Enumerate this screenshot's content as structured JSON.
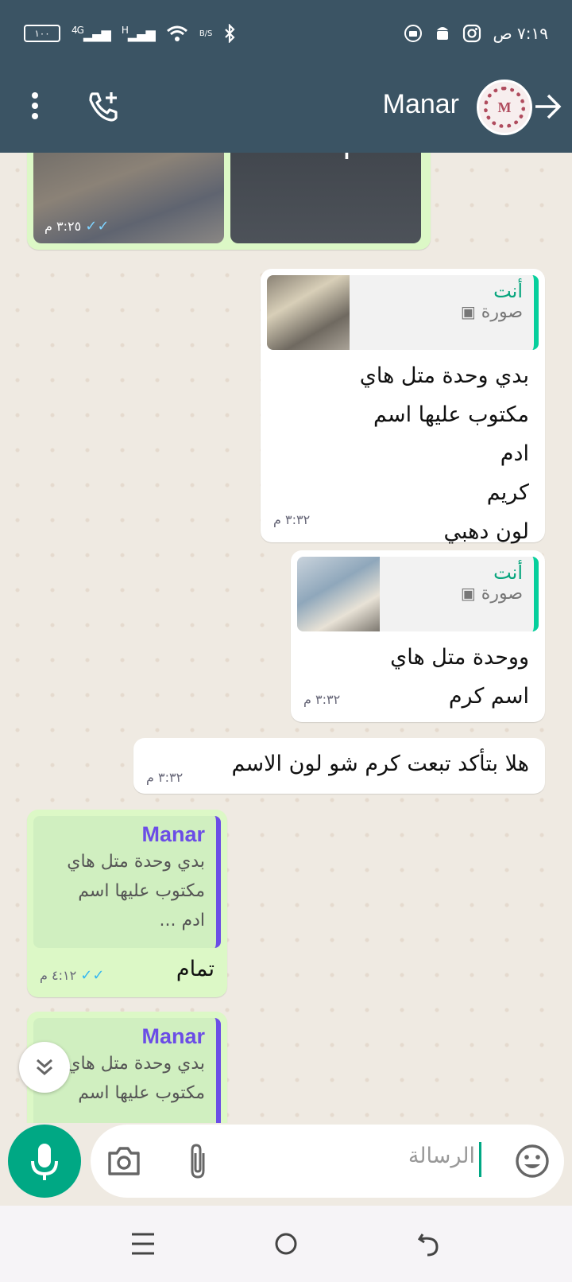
{
  "status_bar": {
    "time": "٧:١٩ ص",
    "battery": "١٠٠",
    "network_4g": "4G",
    "network_h": "H",
    "speed_unit": "B/S"
  },
  "header": {
    "contact_name": "Manar",
    "avatar_letter": "M",
    "colors": {
      "header_bg": "#3b5464",
      "accent": "#00a884"
    }
  },
  "messages": {
    "photo_time": "٣:٢٥ م",
    "photo_overlay": "+",
    "msg1": {
      "quote_name": "أنت",
      "quote_sub": "صورة",
      "lines": [
        "بدي وحدة متل هاي",
        "مكتوب عليها اسم",
        "ادم",
        "كريم",
        "لون دهبي"
      ],
      "time": "٣:٣٢ م"
    },
    "msg2": {
      "quote_name": "أنت",
      "quote_sub": "صورة",
      "lines": [
        "ووحدة متل هاي",
        "اسم كرم"
      ],
      "time": "٣:٣٢ م"
    },
    "msg3": {
      "text": "هلا بتأكد تبعت كرم شو لون الاسم",
      "time": "٣:٣٢ م"
    },
    "msg4": {
      "quote_name": "Manar",
      "quote_lines": [
        "بدي وحدة متل هاي",
        "مكتوب عليها اسم",
        "ادم ..."
      ],
      "text": "تمام",
      "time": "٤:١٢ م"
    },
    "msg5": {
      "quote_name": "Manar",
      "quote_lines": [
        "بدي وحدة متل هاي",
        "مكتوب عليها اسم"
      ]
    }
  },
  "composer": {
    "placeholder": "الرسالة"
  }
}
